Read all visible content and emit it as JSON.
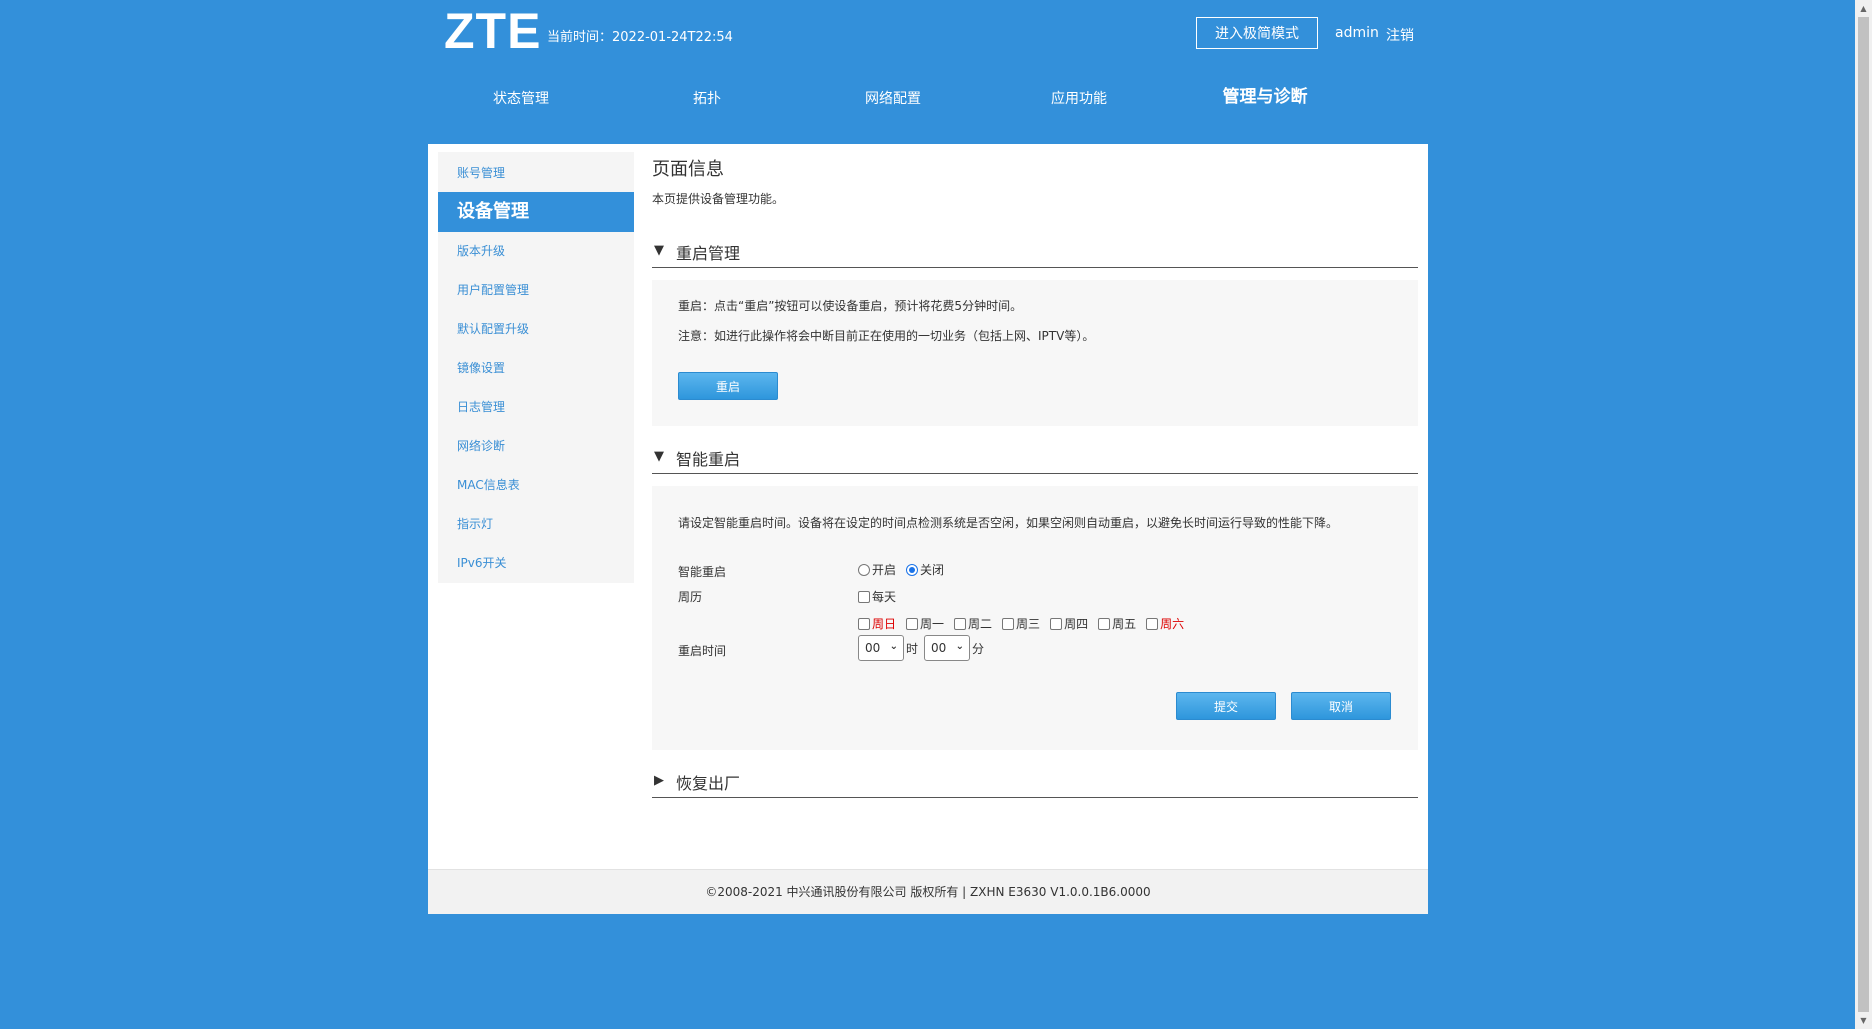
{
  "header": {
    "logo": "ZTE",
    "current_time": "当前时间：2022-01-24T22:54",
    "simple_mode_button": "进入极简模式",
    "user": "admin",
    "logout": "注销"
  },
  "nav": {
    "items": [
      "状态管理",
      "拓扑",
      "网络配置",
      "应用功能",
      "管理与诊断"
    ],
    "active": "管理与诊断"
  },
  "sidebar": {
    "items": [
      "账号管理",
      "设备管理",
      "版本升级",
      "用户配置管理",
      "默认配置升级",
      "镜像设置",
      "日志管理",
      "网络诊断",
      "MAC信息表",
      "指示灯",
      "IPv6开关"
    ],
    "active": "设备管理"
  },
  "page": {
    "title": "页面信息",
    "description": "本页提供设备管理功能。"
  },
  "reboot": {
    "title": "重启管理",
    "note1": "重启：点击“重启”按钮可以使设备重启，预计将花费5分钟时间。",
    "note2": "注意：如进行此操作将会中断目前正在使用的一切业务（包括上网、IPTV等）。",
    "button": "重启"
  },
  "smart_reboot": {
    "title": "智能重启",
    "description": "请设定智能重启时间。设备将在设定的时间点检测系统是否空闲，如果空闲则自动重启，以避免长时间运行导致的性能下降。",
    "enable_label": "智能重启",
    "on_label": "开启",
    "off_label": "关闭",
    "selected": "关闭",
    "calendar_label": "周历",
    "everyday_label": "每天",
    "days": [
      "周日",
      "周一",
      "周二",
      "周三",
      "周四",
      "周五",
      "周六"
    ],
    "time_label": "重启时间",
    "hour_value": "00",
    "hour_unit": "时",
    "minute_value": "00",
    "minute_unit": "分",
    "submit": "提交",
    "cancel": "取消"
  },
  "factory_reset": {
    "title": "恢复出厂"
  },
  "footer": {
    "text": "©2008-2021 中兴通讯股份有限公司 版权所有 |   ZXHN E3630 V1.0.0.1B6.0000"
  },
  "colors": {
    "background": "#3390da",
    "accent": "#3390da",
    "weekend": "#dd0000"
  }
}
